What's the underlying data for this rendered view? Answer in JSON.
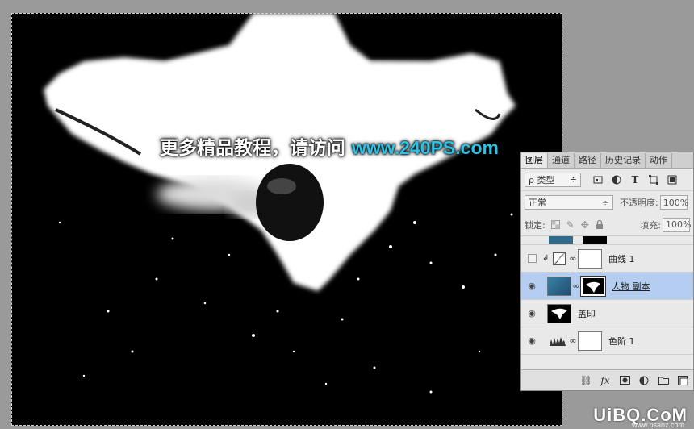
{
  "watermark": {
    "text_cn": "更多精品教程，请访问",
    "url": "www.240PS.com"
  },
  "footer": {
    "brand": "UiBQ.CoM",
    "sub": "www.psahz.com"
  },
  "layers_panel": {
    "tabs": [
      "图层",
      "通道",
      "路径",
      "历史记录",
      "动作"
    ],
    "active_tab": 0,
    "filter": {
      "kind_label": "类型",
      "kind_prefix": "ρ",
      "arrows": "÷"
    },
    "blend_mode": "正常",
    "opacity_label": "不透明度:",
    "opacity_value": "100%",
    "lock_label": "锁定:",
    "fill_label": "填充:",
    "fill_value": "100%",
    "layers": [
      {
        "name": "曲线 1",
        "visible": false,
        "selected": false
      },
      {
        "name": "人物 副本",
        "visible": true,
        "selected": true
      },
      {
        "name": "盖印",
        "visible": true,
        "selected": false
      },
      {
        "name": "色阶 1",
        "visible": true,
        "selected": false
      }
    ]
  },
  "colors": {
    "accent_url": "#28c3e6",
    "selected_row": "#b4cdf1",
    "canvas_bg": "#000000",
    "workspace": "#9a9a9a"
  }
}
